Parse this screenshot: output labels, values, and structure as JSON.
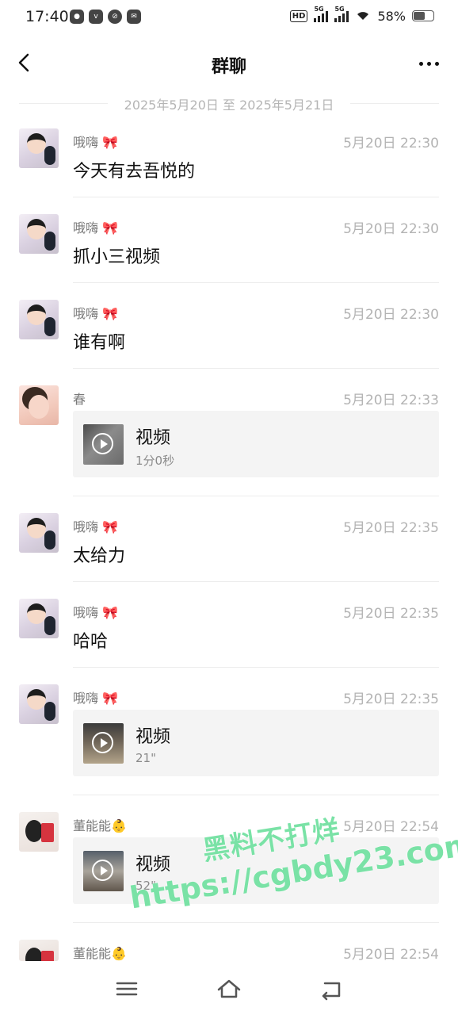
{
  "status_bar": {
    "time": "17:40",
    "network_hd": "HD",
    "signal1": "5G",
    "signal2": "5G",
    "battery": "58%",
    "battery_level": 0.58
  },
  "header": {
    "title": "群聊",
    "back_icon": "chevron-left-icon",
    "more_icon": "more-horizontal-icon"
  },
  "date_range": "2025年5月20日 至 2025年5月21日",
  "messages": [
    {
      "sender": "哦嗨 🎀",
      "time": "5月20日 22:30",
      "text": "今天有去吾悦的"
    },
    {
      "sender": "哦嗨 🎀",
      "time": "5月20日 22:30",
      "text": "抓小三视频"
    },
    {
      "sender": "哦嗨 🎀",
      "time": "5月20日 22:30",
      "text": "谁有啊"
    },
    {
      "sender": "春",
      "time": "5月20日 22:33",
      "video_label": "视频",
      "video_duration": "1分0秒"
    },
    {
      "sender": "哦嗨 🎀",
      "time": "5月20日 22:35",
      "text": "太给力"
    },
    {
      "sender": "哦嗨 🎀",
      "time": "5月20日 22:35",
      "text": "哈哈"
    },
    {
      "sender": "哦嗨 🎀",
      "time": "5月20日 22:35",
      "video_label": "视频",
      "video_duration": "21\""
    },
    {
      "sender": "董能能👶",
      "time": "5月20日 22:54",
      "video_label": "视频",
      "video_duration": "52\""
    },
    {
      "sender": "董能能👶",
      "time": "5月20日 22:54"
    }
  ],
  "watermark": {
    "line1": "黑料不打烊",
    "line2": "https://cgbdy23.com"
  },
  "nav_bar": {
    "menu_icon": "menu-icon",
    "home_icon": "home-icon",
    "back_icon": "back-icon"
  }
}
